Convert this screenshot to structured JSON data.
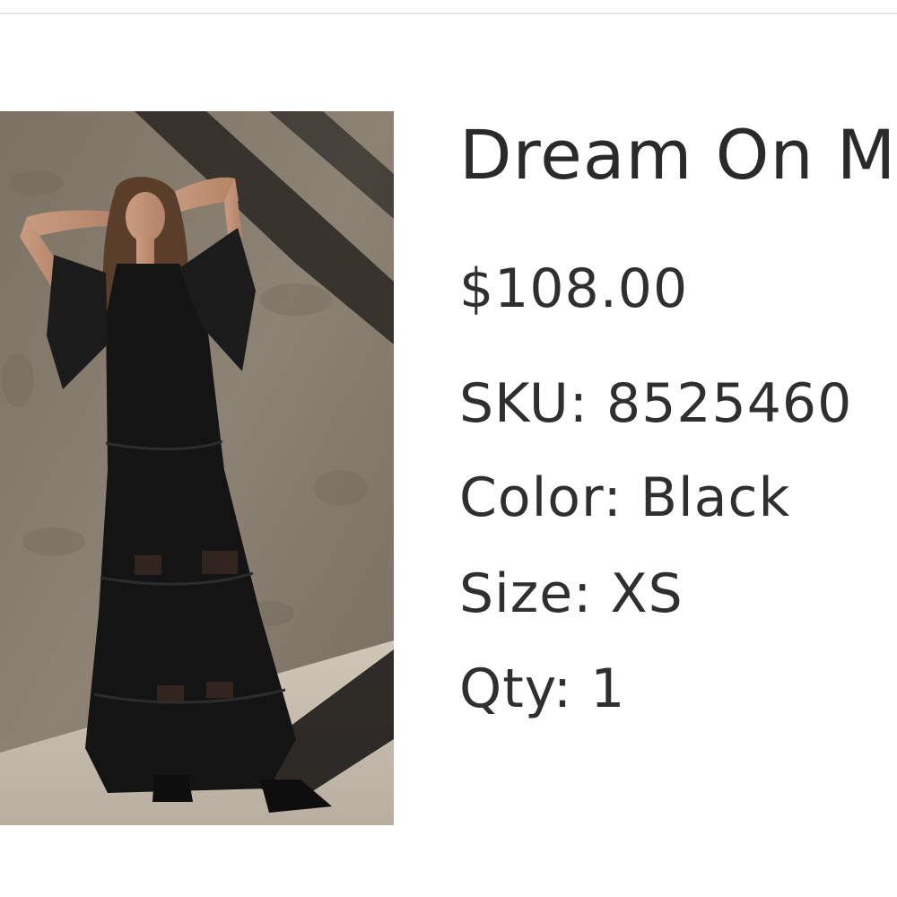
{
  "product": {
    "name": "Dream On M",
    "price": "$108.00",
    "sku_label": "SKU:",
    "sku_value": "8525460",
    "color_label": "Color:",
    "color_value": "Black",
    "size_label": "Size:",
    "size_value": "XS",
    "qty_label": "Qty:",
    "qty_value": "1"
  },
  "image": {
    "subject": "model in long black tiered maxi dress against a concrete wall"
  }
}
